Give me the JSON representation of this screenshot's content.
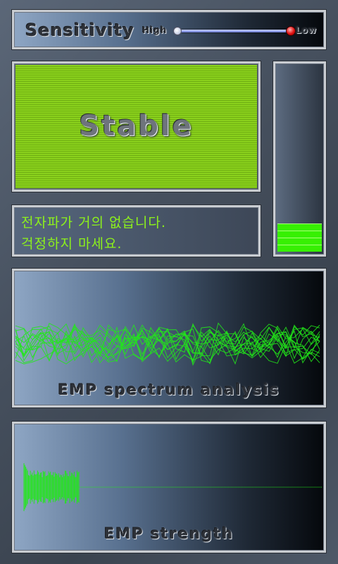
{
  "sensitivity": {
    "label": "Sensitivity",
    "high_label": "High",
    "low_label": "Low",
    "slider_value": 1.0
  },
  "status": {
    "word": "Stable",
    "screen_color": "#8ad11c"
  },
  "message": {
    "line1": "전자파가 거의 없습니다.",
    "line2": "걱정하지 마세요."
  },
  "meter": {
    "total_segments": 28,
    "lit_segments": 4,
    "lit_color": "#37f002"
  },
  "spectrum": {
    "title": "EMP spectrum analysis",
    "line_color": "#22e81a"
  },
  "strength": {
    "title": "EMP strength",
    "line_color": "#22e81a"
  }
}
